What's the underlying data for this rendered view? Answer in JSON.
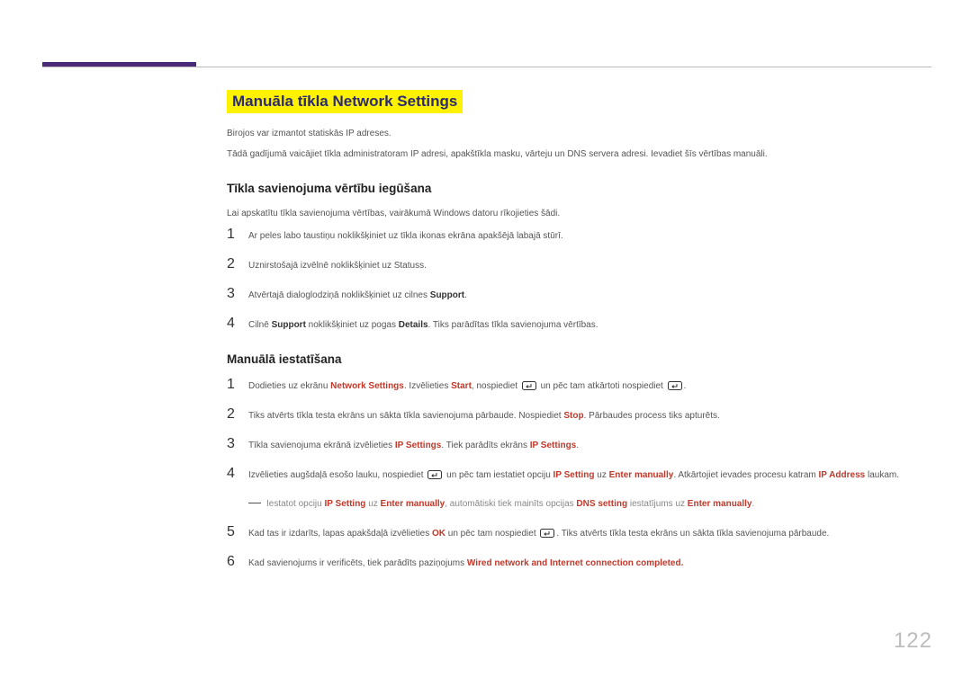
{
  "title": "Manuāla tīkla Network Settings",
  "body1": "Birojos var izmantot statiskās IP adreses.",
  "body2": "Tādā gadījumā vaicājiet tīkla administratoram IP adresi, apakštīkla masku, vārteju un DNS servera adresi. Ievadiet šīs vērtības manuāli.",
  "section1": {
    "title": "Tīkla savienojuma vērtību iegūšana",
    "intro": "Lai apskatītu tīkla savienojuma vērtības, vairākumā Windows datoru rīkojieties šādi.",
    "steps": [
      "Ar peles labo taustiņu noklikšķiniet uz tīkla ikonas ekrāna apakšējā labajā stūrī.",
      "Uznirstošajā izvēlnē noklikšķiniet uz Statuss.",
      "Atvērtajā dialoglodziņā noklikšķiniet uz cilnes",
      "Cilnē"
    ],
    "support": "Support",
    "details": "Details",
    "s3_tail": ".",
    "s4_mid": " noklikšķiniet uz pogas ",
    "s4_tail": ". Tiks parādītas tīkla savienojuma vērtības."
  },
  "section2": {
    "title": "Manuālā iestatīšana",
    "network_settings": "Network Settings",
    "start": "Start",
    "stop": "Stop",
    "ip_settings": "IP Settings",
    "ip_setting": "IP Setting",
    "enter_manually": "Enter manually",
    "ip_address": "IP Address",
    "ok": "OK",
    "dns_setting": "DNS setting",
    "completed": "Wired network and Internet connection completed.",
    "s1_a": "Dodieties uz ekrānu ",
    "s1_b": ". Izvēlieties ",
    "s1_c": ", nospiediet ",
    "s1_d": " un pēc tam atkārtoti nospiediet ",
    "s1_e": ".",
    "s2_a": "Tiks atvērts tīkla testa ekrāns un sākta tīkla savienojuma pārbaude. Nospiediet ",
    "s2_b": ". Pārbaudes process tiks apturēts.",
    "s3_a": "Tīkla savienojuma ekrānā izvēlieties ",
    "s3_b": ". Tiek parādīts ekrāns ",
    "s3_c": ".",
    "s4_a": "Izvēlieties augšdaļā esošo lauku, nospiediet ",
    "s4_b": " un pēc tam iestatiet opciju ",
    "s4_c": " uz ",
    "s4_d": ". Atkārtojiet ievades procesu katram ",
    "s4_e": " laukam.",
    "note_a": "Iestatot opciju ",
    "note_b": " uz ",
    "note_c": ", automātiski tiek mainīts opcijas ",
    "note_d": " iestatījums uz ",
    "note_e": ".",
    "s5_a": "Kad tas ir izdarīts, lapas apakšdaļā izvēlieties ",
    "s5_b": " un pēc tam nospiediet ",
    "s5_c": ". Tiks atvērts tīkla testa ekrāns un sākta tīkla savienojuma pārbaude.",
    "s6_a": "Kad savienojums ir verificēts, tiek parādīts paziņojums "
  },
  "page": "122"
}
